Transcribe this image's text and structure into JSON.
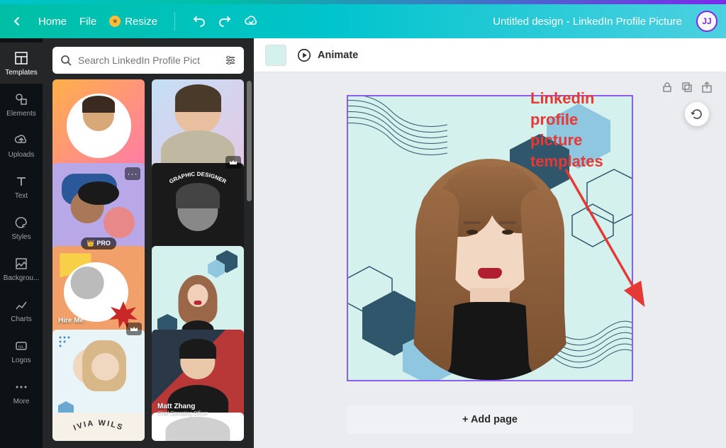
{
  "header": {
    "home": "Home",
    "file": "File",
    "resize": "Resize",
    "title": "Untitled design - LinkedIn Profile Picture",
    "avatar_initials": "JJ"
  },
  "nav": {
    "items": [
      {
        "label": "Templates"
      },
      {
        "label": "Elements"
      },
      {
        "label": "Uploads"
      },
      {
        "label": "Text"
      },
      {
        "label": "Styles"
      },
      {
        "label": "Backgrou..."
      },
      {
        "label": "Charts"
      },
      {
        "label": "Logos"
      },
      {
        "label": "More"
      }
    ]
  },
  "search": {
    "placeholder": "Search LinkedIn Profile Pict"
  },
  "templates": [
    {
      "badge": ""
    },
    {
      "crown": true
    },
    {
      "more": true
    },
    {
      "topText": "GRAPHIC DESIGNER"
    },
    {
      "pro": "PRO",
      "hire": "Hire Me",
      "crown": true
    },
    {},
    {},
    {
      "name": "Matt Zhang",
      "role": "Chief Operating Officer"
    },
    {
      "name_partial": "IVIA WILS"
    },
    {}
  ],
  "toolbar": {
    "animate": "Animate"
  },
  "canvas": {
    "add_page": "+ Add page"
  },
  "annotation": {
    "text": "Linkedin\nprofile\npicture\ntemplates"
  },
  "colors": {
    "canvas_bg": "#d5f1ee",
    "hex_dark": "#30566b",
    "hex_light": "#8fc6e0"
  }
}
